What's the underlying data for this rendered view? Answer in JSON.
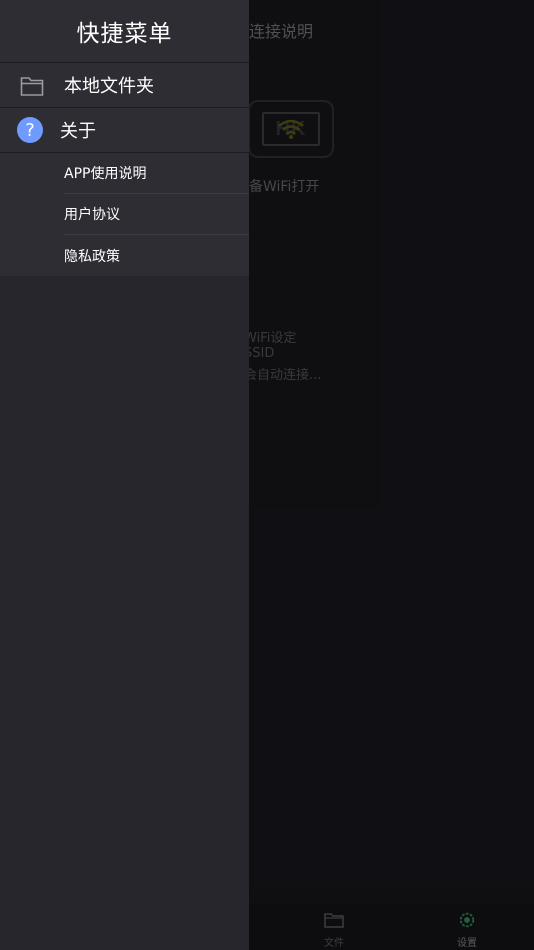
{
  "background": {
    "title": "连接说明",
    "device_logo": "HK",
    "caption": "备WiFi打开",
    "lines": [
      "WiFi设定",
      "SSID",
      "会自动连接..."
    ],
    "tabs": [
      {
        "label": "文件",
        "icon": "folder-icon"
      },
      {
        "label": "设置",
        "icon": "gear-icon"
      }
    ]
  },
  "drawer": {
    "title": "快捷菜单",
    "items": [
      {
        "label": "本地文件夹",
        "icon": "folder-icon"
      },
      {
        "label": "关于",
        "icon": "help-icon"
      }
    ],
    "about_sub": [
      {
        "label": "APP使用说明"
      },
      {
        "label": "用户协议"
      },
      {
        "label": "隐私政策"
      }
    ]
  },
  "colors": {
    "drawer_bg": "#27262c",
    "item_bg": "#2e2d34",
    "help_icon": "#6f9bff",
    "accent_green": "#3fa36b"
  }
}
